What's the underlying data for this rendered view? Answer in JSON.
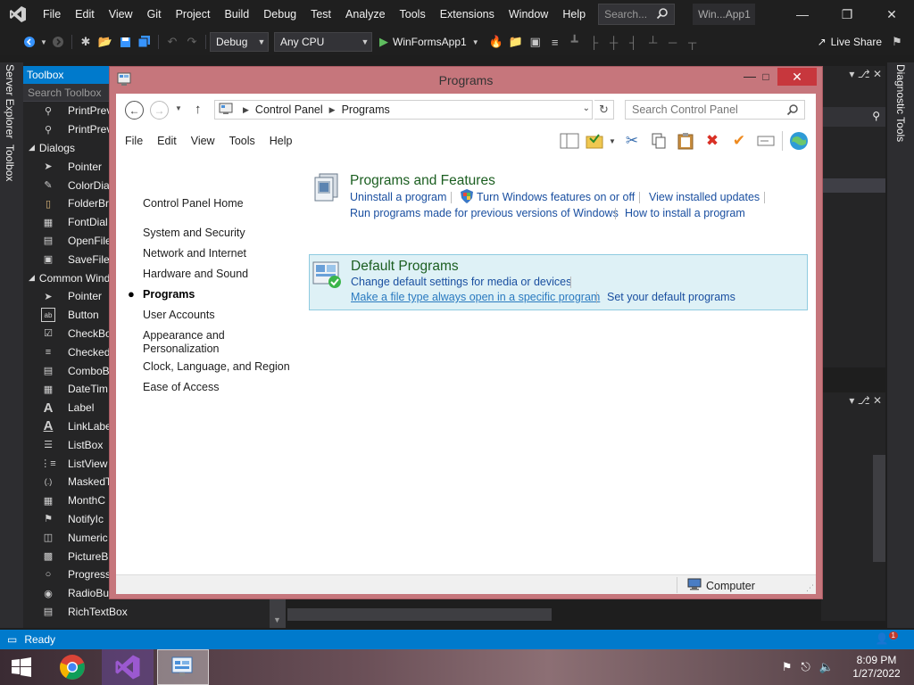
{
  "vs": {
    "menu": [
      "File",
      "Edit",
      "View",
      "Git",
      "Project",
      "Build",
      "Debug",
      "Test",
      "Analyze",
      "Tools",
      "Extensions",
      "Window",
      "Help"
    ],
    "search_placeholder": "Search...",
    "solution_name": "Win...App1",
    "config": "Debug",
    "platform": "Any CPU",
    "startup_project": "WinFormsApp1",
    "live_share": "Live Share",
    "side_tabs": [
      "Server Explorer",
      "Toolbox"
    ],
    "right_tab": "Diagnostic Tools",
    "status": "Ready",
    "notification_count": "1"
  },
  "toolbox": {
    "title": "Toolbox",
    "search_placeholder": "Search Toolbox",
    "rows": [
      {
        "type": "item",
        "label": "PrintPrev",
        "icon": "print-preview-icon"
      },
      {
        "type": "item",
        "label": "PrintPrev",
        "icon": "print-preview-control-icon"
      },
      {
        "type": "category",
        "label": "Dialogs"
      },
      {
        "type": "item",
        "label": "Pointer",
        "icon": "pointer-icon"
      },
      {
        "type": "item",
        "label": "ColorDia",
        "icon": "color-dialog-icon"
      },
      {
        "type": "item",
        "label": "FolderBr",
        "icon": "folder-browser-icon"
      },
      {
        "type": "item",
        "label": "FontDial",
        "icon": "font-dialog-icon"
      },
      {
        "type": "item",
        "label": "OpenFile",
        "icon": "open-file-dialog-icon"
      },
      {
        "type": "item",
        "label": "SaveFileD",
        "icon": "save-file-dialog-icon"
      },
      {
        "type": "category",
        "label": "Common Wind"
      },
      {
        "type": "item",
        "label": "Pointer",
        "icon": "pointer-icon"
      },
      {
        "type": "item",
        "label": "Button",
        "icon": "button-icon"
      },
      {
        "type": "item",
        "label": "CheckBo",
        "icon": "checkbox-icon"
      },
      {
        "type": "item",
        "label": "Checked",
        "icon": "checked-listbox-icon"
      },
      {
        "type": "item",
        "label": "ComboB",
        "icon": "combobox-icon"
      },
      {
        "type": "item",
        "label": "DateTim",
        "icon": "datetime-picker-icon"
      },
      {
        "type": "item",
        "label": "Label",
        "icon": "label-icon"
      },
      {
        "type": "item",
        "label": "LinkLabe",
        "icon": "link-label-icon"
      },
      {
        "type": "item",
        "label": "ListBox",
        "icon": "listbox-icon"
      },
      {
        "type": "item",
        "label": "ListView",
        "icon": "listview-icon"
      },
      {
        "type": "item",
        "label": "MaskedT",
        "icon": "masked-textbox-icon"
      },
      {
        "type": "item",
        "label": "MonthC",
        "icon": "month-calendar-icon"
      },
      {
        "type": "item",
        "label": "NotifyIc",
        "icon": "notify-icon"
      },
      {
        "type": "item",
        "label": "Numeric",
        "icon": "numeric-updown-icon"
      },
      {
        "type": "item",
        "label": "PictureB",
        "icon": "picturebox-icon"
      },
      {
        "type": "item",
        "label": "Progress",
        "icon": "progressbar-icon"
      },
      {
        "type": "item",
        "label": "RadioBu",
        "icon": "radio-button-icon"
      },
      {
        "type": "item",
        "label": "RichTextBox",
        "icon": "rich-textbox-icon"
      }
    ]
  },
  "cp": {
    "window_title": "Programs",
    "breadcrumb": [
      "Control Panel",
      "Programs"
    ],
    "search_placeholder": "Search Control Panel",
    "menu": [
      "File",
      "Edit",
      "View",
      "Tools",
      "Help"
    ],
    "nav": {
      "home": "Control Panel Home",
      "items": [
        "System and Security",
        "Network and Internet",
        "Hardware and Sound",
        "Programs",
        "User Accounts",
        "Appearance and",
        "Personalization",
        "Clock, Language, and Region",
        "Ease of Access"
      ]
    },
    "programs_features": {
      "title": "Programs and Features",
      "links": [
        "Uninstall a program",
        "Turn Windows features on or off",
        "View installed updates",
        "Run programs made for previous versions of Windows",
        "How to install a program"
      ]
    },
    "default_programs": {
      "title": "Default Programs",
      "links": [
        "Change default settings for media or devices",
        "Make a file type always open in a specific program",
        "Set your default programs"
      ]
    },
    "status_location": "Computer"
  },
  "taskbar": {
    "time": "8:09 PM",
    "date": "1/27/2022"
  }
}
